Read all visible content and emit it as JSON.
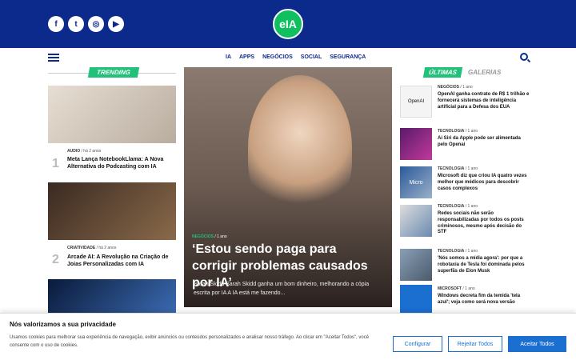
{
  "header": {
    "logo_text": "eIA",
    "social": [
      {
        "icon": "facebook-icon",
        "glyph": "f"
      },
      {
        "icon": "twitter-icon",
        "glyph": "t"
      },
      {
        "icon": "instagram-icon",
        "glyph": "◎"
      },
      {
        "icon": "youtube-icon",
        "glyph": "▶"
      }
    ],
    "menu": [
      "IA",
      "APPS",
      "NEGÓCIOS",
      "SOCIAL",
      "SEGURANÇA"
    ],
    "brand_color": "#0b2a8c",
    "accent_color": "#22c17a"
  },
  "trending": {
    "label": "TRENDING",
    "items": [
      {
        "num": "1",
        "category": "AUDIO",
        "time": "há 2 anos",
        "title": "Meta Lança NotebookLlama: A Nova Alternativa do Podcasting com IA"
      },
      {
        "num": "2",
        "category": "CRIATIVIDADE",
        "time": "há 2 anos",
        "title": "Arcade AI: A Revolução na Criação de Joias Personalizadas com IA"
      }
    ]
  },
  "hero": {
    "category": "NEGÓCIOS",
    "time": "1 ano",
    "title": "‘Estou sendo paga para corrigir problemas causados por IA’",
    "excerpt": "Sarah Skidd Sarah Skidd ganha um bom dinheiro, melhorando a cópia escrita por IA A IA está me fazendo..."
  },
  "latest": {
    "label": "ÚLTIMAS",
    "galleries_label": "GALERIAS",
    "items": [
      {
        "category": "NEGÓCIOS",
        "time": "1 ano",
        "title": "OpenAI ganha contrato de R$ 1 trilhão e fornecerá sistemas de inteligência artificial para a Defesa dos EUA",
        "thumb_text": "OpenAI"
      },
      {
        "category": "TECNOLOGIA",
        "time": "1 ano",
        "title": "Ai Siri da Apple pode ser alimentada pelo Openai",
        "thumb_text": ""
      },
      {
        "category": "TECNOLOGIA",
        "time": "1 ano",
        "title": "Microsoft diz que criou IA quatro vezes melhor que médicos para descobrir casos complexos",
        "thumb_text": "Micro"
      },
      {
        "category": "TECNOLOGIA",
        "time": "1 ano",
        "title": "Redes sociais não serão responsabilizadas por todos os posts criminosos, mesmo após decisão do STF",
        "thumb_text": ""
      },
      {
        "category": "TECNOLOGIA",
        "time": "1 ano",
        "title": "'Nós somos a mídia agora': por que a robotaxia de Tesla foi dominada pelos superfãs de Elon Musk",
        "thumb_text": ""
      },
      {
        "category": "MICROSOFT",
        "time": "1 ano",
        "title": "Windows decreta fim da temida 'tela azul'; veja como será nova versão",
        "thumb_text": ""
      }
    ]
  },
  "cookie": {
    "title": "Nós valorizamos a sua privacidade",
    "text": "Usamos cookies para melhorar sua experiência de navegação, exibir anúncios ou conteúdos personalizados e analisar nosso tráfego. Ao clicar em \"Aceitar Todos\", você consente com o uso de cookies.",
    "configure": "Configurar",
    "reject": "Rejeitar Todos",
    "accept": "Aceitar Todos"
  }
}
